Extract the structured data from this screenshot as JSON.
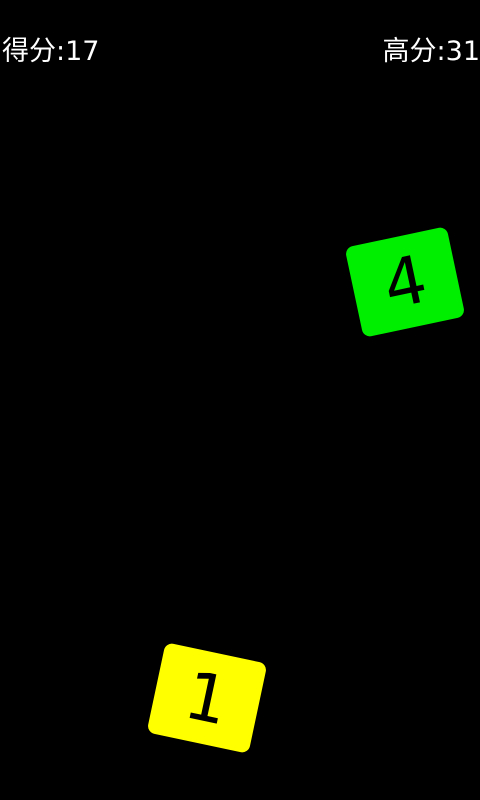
{
  "hud": {
    "score_text": "得分:17",
    "high_score_text": "高分:31"
  },
  "blocks": [
    {
      "label": "4",
      "color": "#00ee00"
    },
    {
      "label": "1",
      "color": "#ffff00"
    }
  ],
  "colors": {
    "background": "#000000",
    "hud_text": "#ffffff",
    "block_text": "#000000"
  }
}
